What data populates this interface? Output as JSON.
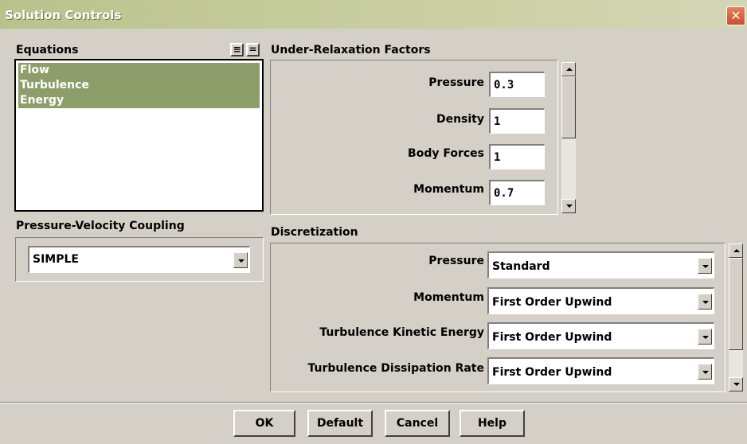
{
  "window": {
    "title": "Solution Controls",
    "close_glyph": "✕"
  },
  "equations": {
    "label": "Equations",
    "select_all_glyph": "≡",
    "deselect_glyph": "=",
    "items": [
      "Flow",
      "Turbulence",
      "Energy"
    ]
  },
  "urf": {
    "label": "Under-Relaxation Factors",
    "rows": [
      {
        "label": "Pressure",
        "value": "0.3"
      },
      {
        "label": "Density",
        "value": "1"
      },
      {
        "label": "Body Forces",
        "value": "1"
      },
      {
        "label": "Momentum",
        "value": "0.7"
      }
    ]
  },
  "pvc": {
    "label": "Pressure-Velocity Coupling",
    "value": "SIMPLE"
  },
  "discretization": {
    "label": "Discretization",
    "rows": [
      {
        "label": "Pressure",
        "value": "Standard"
      },
      {
        "label": "Momentum",
        "value": "First Order Upwind"
      },
      {
        "label": "Turbulence Kinetic Energy",
        "value": "First Order Upwind"
      },
      {
        "label": "Turbulence Dissipation Rate",
        "value": "First Order Upwind"
      }
    ]
  },
  "buttons": {
    "ok": "OK",
    "default": "Default",
    "cancel": "Cancel",
    "help": "Help"
  },
  "colors": {
    "selection": "#8e9e6a",
    "titlebar": "#b9c28c",
    "dialog_bg": "#d4d0c8"
  }
}
